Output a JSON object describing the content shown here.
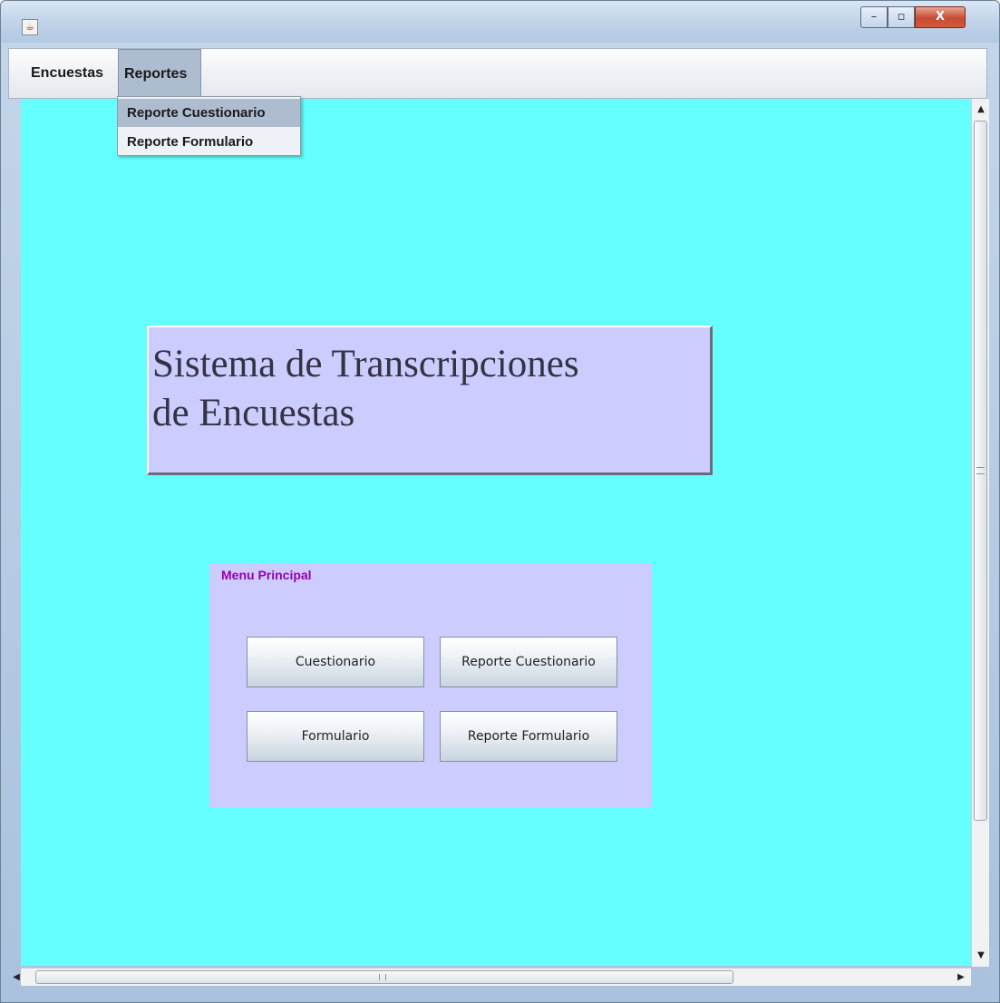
{
  "window": {
    "icon": "java-app-icon",
    "controls": {
      "minimize": "–",
      "maximize": "▫",
      "close": "X"
    }
  },
  "menubar": {
    "items": [
      {
        "label": "Encuestas"
      },
      {
        "label": "Reportes"
      }
    ]
  },
  "dropdown": {
    "items": [
      {
        "label": "Reporte Cuestionario"
      },
      {
        "label": "Reporte Formulario"
      }
    ]
  },
  "title": {
    "line1": "Sistema de Transcripciones",
    "line2": "de Encuestas"
  },
  "panel": {
    "title": "Menu Principal",
    "buttons": [
      {
        "label": "Cuestionario"
      },
      {
        "label": "Reporte Cuestionario"
      },
      {
        "label": "Formulario"
      },
      {
        "label": "Reporte Formulario"
      }
    ]
  },
  "scrollbars": {
    "up": "▲",
    "down": "▼",
    "left": "◀",
    "right": "▶"
  },
  "colors": {
    "content_bg": "#66ffff",
    "panel_bg": "#ccccff",
    "panel_title": "#9900aa",
    "menu_highlight": "#aebcd0"
  }
}
